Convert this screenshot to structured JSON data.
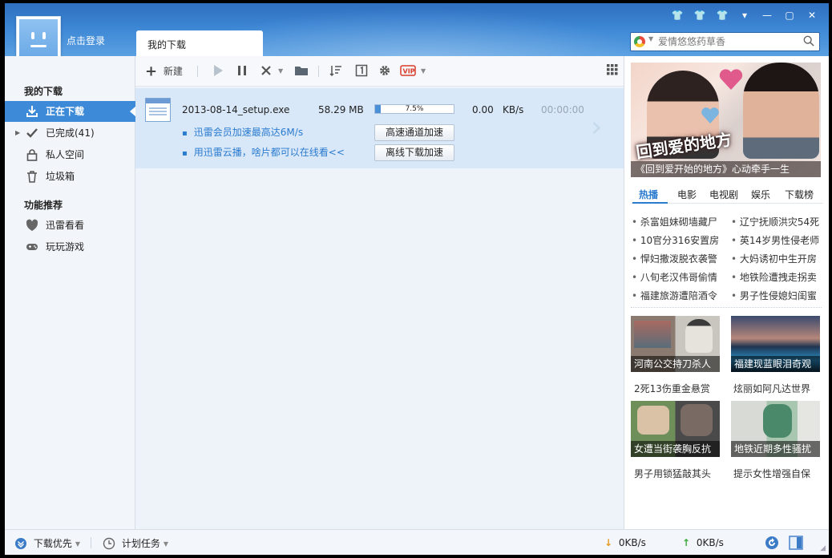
{
  "header": {
    "login": "点击登录",
    "main_tab": "我的下载",
    "search_placeholder": "爱情悠悠药草香"
  },
  "sidebar": {
    "section1": "我的下载",
    "items": [
      {
        "label": "正在下载",
        "icon": "download-icon"
      },
      {
        "label": "已完成(41)",
        "icon": "check-icon"
      },
      {
        "label": "私人空间",
        "icon": "lock-icon"
      },
      {
        "label": "垃圾箱",
        "icon": "trash-icon"
      }
    ],
    "section2": "功能推荐",
    "features": [
      {
        "label": "迅雷看看",
        "icon": "heart-shield-icon"
      },
      {
        "label": "玩玩游戏",
        "icon": "gamepad-icon"
      }
    ]
  },
  "toolbar": {
    "new_label": "新建"
  },
  "task": {
    "filename": "2013-08-14_setup.exe",
    "size": "58.29 MB",
    "progress_pct": "7.5%",
    "progress": 0.075,
    "speed": "0.00",
    "speed_unit": "KB/s",
    "time": "00:00:00",
    "promo1": "迅雷会员加速最高达6M/s",
    "promo2": "用迅雷云播，啥片都可以在线看<<",
    "btn_high_speed": "高速通道加速",
    "btn_offline": "离线下载加速"
  },
  "right": {
    "banner_caption": "《回到爱开始的地方》心动牵手一生",
    "banner_logo": "回到爱的地方",
    "tabs": [
      "热播",
      "电影",
      "电视剧",
      "娱乐",
      "下载榜"
    ],
    "news_left": [
      "杀富姐妹砌墙藏尸",
      "10官分316安置房",
      "悍妇撒泼脱衣袭警",
      "八旬老汉伟哥偷情",
      "福建旅游遭陪酒令"
    ],
    "news_right": [
      "辽宁抚顺洪灾54死",
      "英14岁男性侵老师",
      "大妈诱初中生开房",
      "地铁险遭拽走拐卖",
      "男子性侵媳妇闺蜜"
    ],
    "thumbs": [
      {
        "caption": "河南公交持刀杀人",
        "sub": "2死13伤重金悬赏"
      },
      {
        "caption": "福建现蓝眼泪奇观",
        "sub": "炫丽如阿凡达世界"
      },
      {
        "caption": "女遭当街袭胸反抗",
        "sub": "男子用锁猛敲其头"
      },
      {
        "caption": "地铁近期多性骚扰",
        "sub": "提示女性增强自保"
      }
    ]
  },
  "status": {
    "priority": "下载优先",
    "schedule": "计划任务",
    "down_speed": "0KB/s",
    "up_speed": "0KB/s"
  },
  "colors": {
    "accent": "#3c8ad8",
    "link": "#2b7bcf",
    "header_top": "#2f6fbf"
  }
}
